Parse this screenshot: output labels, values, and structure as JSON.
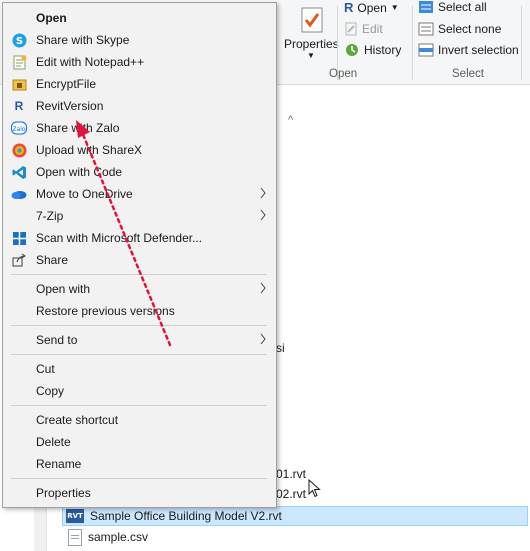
{
  "ribbon": {
    "properties_label": "Properties",
    "open_label": "Open",
    "edit_label": "Edit",
    "history_label": "History",
    "open_group_label": "Open",
    "select_all_label": "Select all",
    "select_none_label": "Select none",
    "invert_selection_label": "Invert selection",
    "select_group_label": "Select"
  },
  "files": {
    "fragment_si": "si",
    "fragment_01": "01.rvt",
    "fragment_02": "02.rvt",
    "selected_file": "Sample Office Building Model V2.rvt",
    "csv_file": "sample.csv",
    "rvt_icon_text": "RVT"
  },
  "context_menu": {
    "open": "Open",
    "share_skype": "Share with Skype",
    "edit_notepad": "Edit with Notepad++",
    "encrypt_file": "EncryptFile",
    "revit_version": "RevitVersion",
    "share_zalo": "Share with Zalo",
    "upload_sharex": "Upload with ShareX",
    "open_code": "Open with Code",
    "move_onedrive": "Move to OneDrive",
    "seven_zip": "7-Zip",
    "scan_defender": "Scan with Microsoft Defender...",
    "share": "Share",
    "open_with": "Open with",
    "restore_versions": "Restore previous versions",
    "send_to": "Send to",
    "cut": "Cut",
    "copy": "Copy",
    "create_shortcut": "Create shortcut",
    "delete": "Delete",
    "rename": "Rename",
    "properties": "Properties"
  },
  "icons": {
    "skype": "skype-icon",
    "notepad": "notepad-plus-plus-icon",
    "encrypt": "encrypt-file-icon",
    "revit": "revit-icon",
    "zalo": "zalo-icon",
    "sharex": "sharex-icon",
    "vscode": "vscode-icon",
    "onedrive": "onedrive-icon",
    "defender": "defender-icon",
    "share": "share-icon"
  },
  "colors": {
    "annotation_arrow": "#e0143c",
    "selection_bg": "#cce8ff",
    "menu_bg": "#f2f2f2"
  }
}
